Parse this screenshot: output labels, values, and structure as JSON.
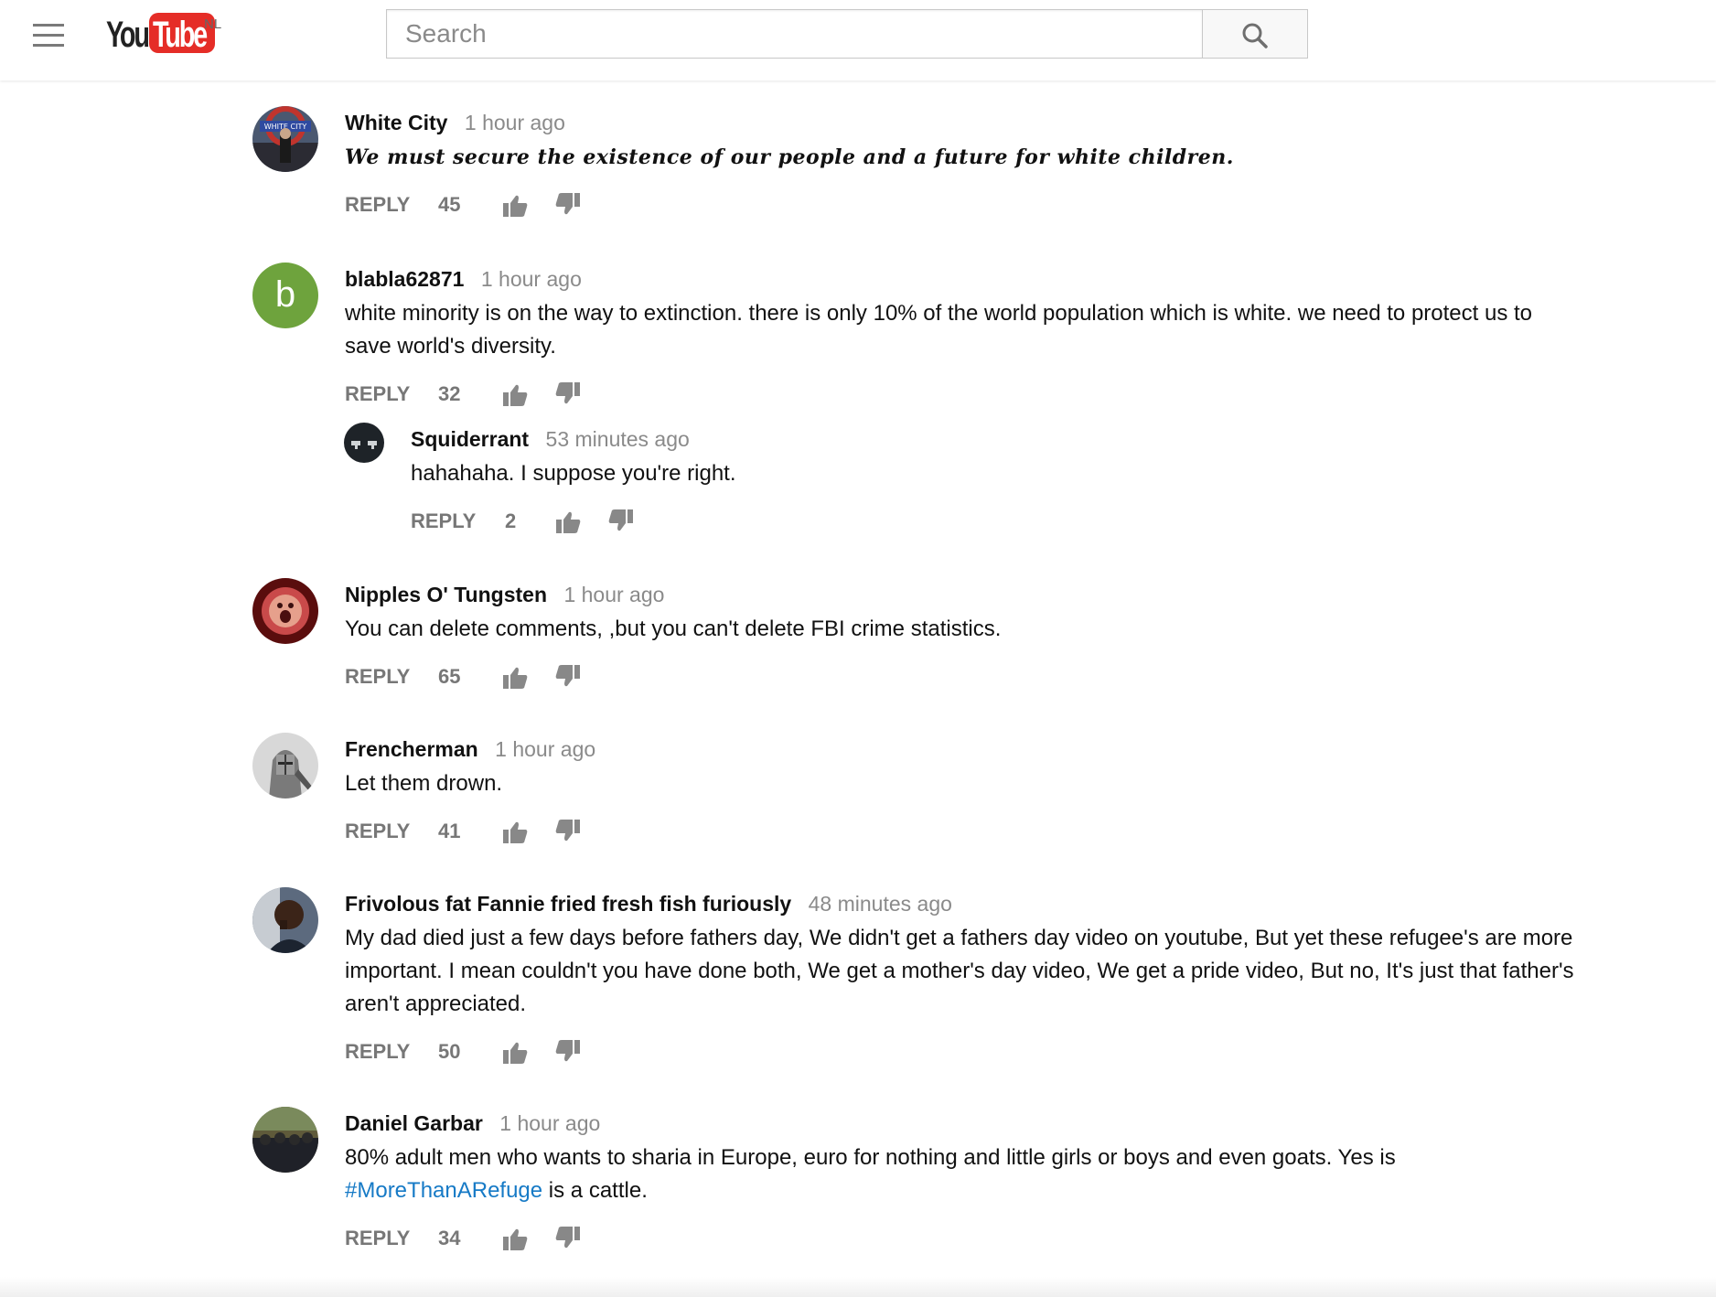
{
  "header": {
    "logo_you": "You",
    "logo_tube": "Tube",
    "logo_country": "NL",
    "search_placeholder": "Search"
  },
  "comments": [
    {
      "author": "White City",
      "time": "1 hour ago",
      "text": "We must secure the existence of our people and a future for white children.",
      "reply_label": "REPLY",
      "likes": "45",
      "avatar": "white-city-avatar"
    },
    {
      "author": "blabla62871",
      "time": "1 hour ago",
      "text": "white minority is on the way to extinction. there is only 10% of the world population which is white. we need to protect us to save world's diversity.",
      "reply_label": "REPLY",
      "likes": "32",
      "avatar_letter": "b",
      "avatar_color": "#6ea33d",
      "replies": [
        {
          "author": "Squiderrant",
          "time": "53 minutes ago",
          "text": "hahahaha. I suppose you're right.",
          "reply_label": "REPLY",
          "likes": "2"
        }
      ]
    },
    {
      "author": "Nipples O' Tungsten",
      "time": "1 hour ago",
      "text": "You can delete comments, ,but you can't delete FBI crime statistics.",
      "reply_label": "REPLY",
      "likes": "65"
    },
    {
      "author": "Frencherman",
      "time": "1 hour ago",
      "text": "Let them drown.",
      "reply_label": "REPLY",
      "likes": "41"
    },
    {
      "author": "Frivolous fat Fannie fried fresh fish furiously",
      "time": "48 minutes ago",
      "text": "My dad died just a few days before fathers day, We didn't get a fathers day video on youtube, But yet these refugee's are more important. I mean couldn't you have done both, We get a mother's day video, We get a pride video, But no, It's just that father's aren't appreciated.",
      "reply_label": "REPLY",
      "likes": "50"
    },
    {
      "author": "Daniel Garbar",
      "time": "1 hour ago",
      "text_before": "80% adult men who wants to sharia in Europe, euro for nothing and little girls or boys and even goats. Yes is",
      "hashtag": "#MoreThanARefuge",
      "text_after": " is a cattle.",
      "reply_label": "REPLY",
      "likes": "34"
    }
  ],
  "colors": {
    "youtube_red": "#e52d27",
    "link_blue": "#167ac6",
    "muted_gray": "#8a8a8a"
  }
}
